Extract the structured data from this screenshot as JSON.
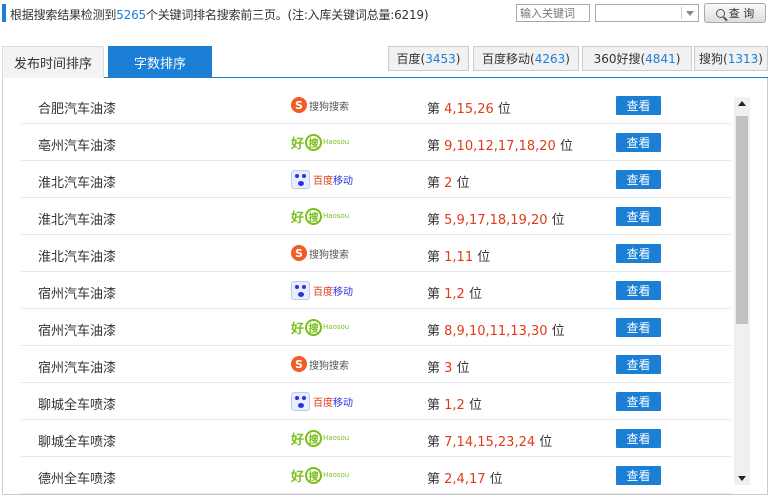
{
  "header": {
    "summary_prefix": "根据搜索结果检测到",
    "summary_count": "5265",
    "summary_suffix": "个关键词排名搜索前三页。(注:入库关键词总量:6219)",
    "keyword_placeholder": "输入关键词",
    "query_label": "查 询"
  },
  "tabs": [
    {
      "label": "发布时间排序",
      "active": false
    },
    {
      "label": "字数排序",
      "active": true
    }
  ],
  "engines": [
    {
      "name": "百度",
      "count": "3453"
    },
    {
      "name": "百度移动",
      "count": "4263"
    },
    {
      "name": "360好搜",
      "count": "4841"
    },
    {
      "name": "搜狗",
      "count": "1313"
    }
  ],
  "rank_prefix": "第",
  "rank_suffix": "位",
  "view_label": "查看",
  "engine_logo_text": {
    "sogou_mark": "S",
    "sogou": "搜狗搜索",
    "hao_1": "好",
    "hao_2": "搜",
    "hao_3": "Haosou",
    "baidu_mobile_1": "百度",
    "baidu_mobile_2": "移动"
  },
  "rows": [
    {
      "keyword": "合肥汽车油漆",
      "engine": "sogou",
      "positions": "4,15,26"
    },
    {
      "keyword": "亳州汽车油漆",
      "engine": "haosou",
      "positions": "9,10,12,17,18,20"
    },
    {
      "keyword": "淮北汽车油漆",
      "engine": "baidu_mobile",
      "positions": "2"
    },
    {
      "keyword": "淮北汽车油漆",
      "engine": "haosou",
      "positions": "5,9,17,18,19,20"
    },
    {
      "keyword": "淮北汽车油漆",
      "engine": "sogou",
      "positions": "1,11"
    },
    {
      "keyword": "宿州汽车油漆",
      "engine": "baidu_mobile",
      "positions": "1,2"
    },
    {
      "keyword": "宿州汽车油漆",
      "engine": "haosou",
      "positions": "8,9,10,11,13,30"
    },
    {
      "keyword": "宿州汽车油漆",
      "engine": "sogou",
      "positions": "3"
    },
    {
      "keyword": "聊城全车喷漆",
      "engine": "baidu_mobile",
      "positions": "1,2"
    },
    {
      "keyword": "聊城全车喷漆",
      "engine": "haosou",
      "positions": "7,14,15,23,24"
    },
    {
      "keyword": "德州全车喷漆",
      "engine": "haosou",
      "positions": "2,4,17"
    }
  ],
  "colors": {
    "accent": "#1b7fd6",
    "rank_highlight": "#e03b1a",
    "sogou_logo": "#f35a25",
    "haosou_logo": "#7bbf1f",
    "baidu_blue": "#2932e1"
  }
}
